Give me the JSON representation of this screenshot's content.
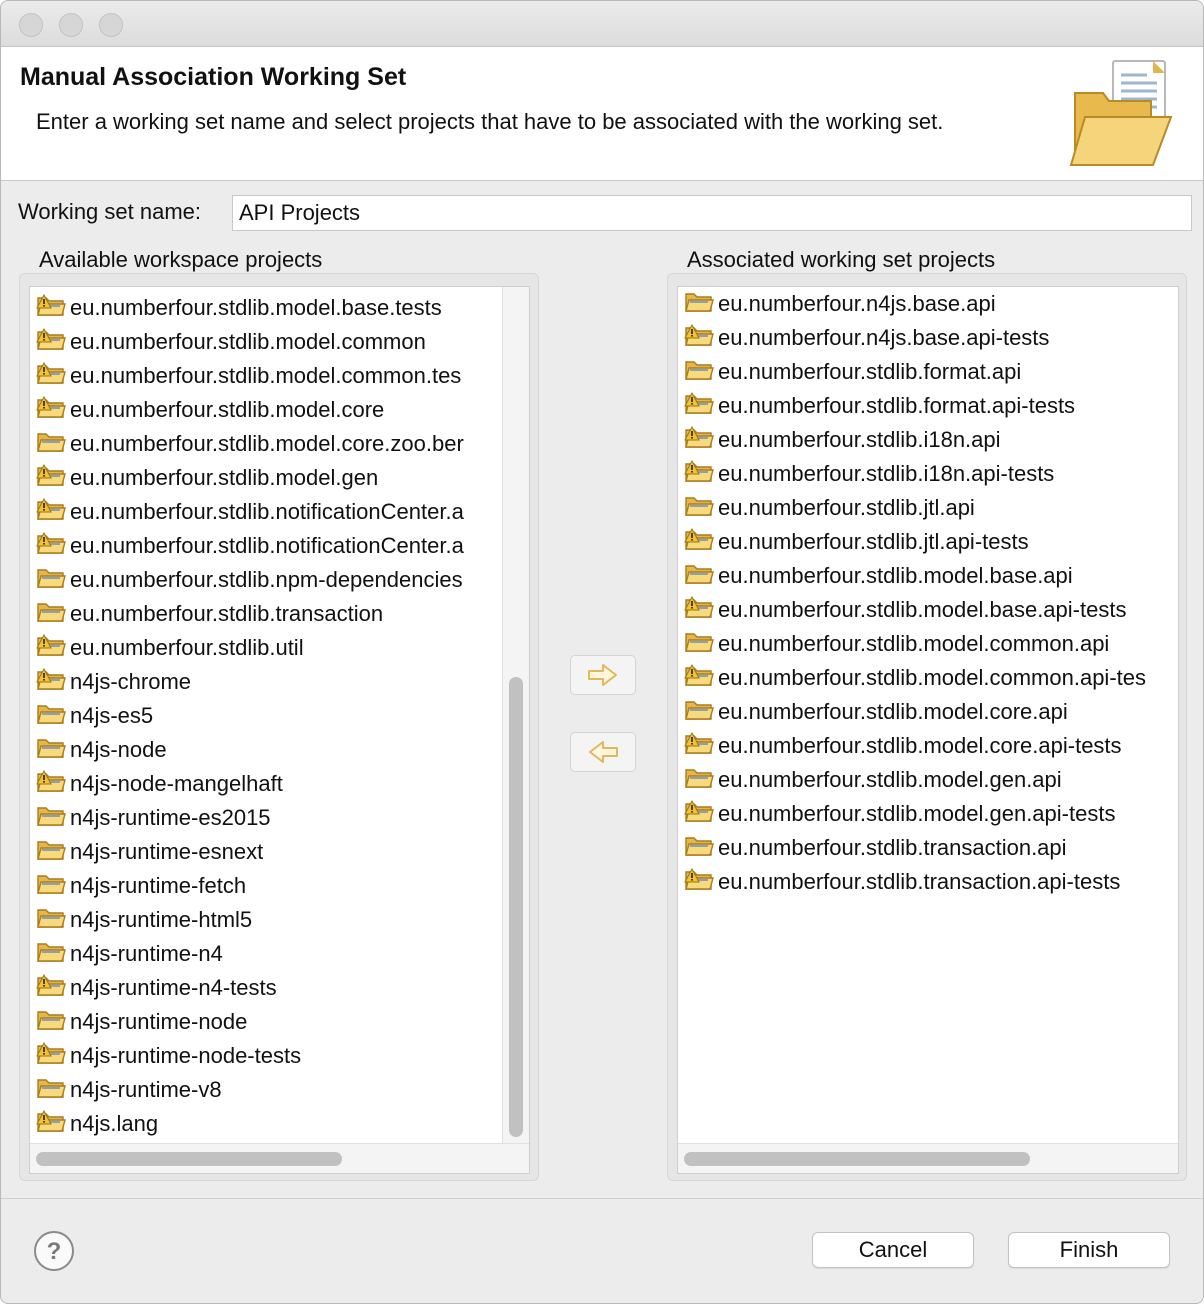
{
  "dialog": {
    "title": "Manual Association Working Set",
    "description": "Enter a working set name and select projects that have to be associated with the working set."
  },
  "working_set": {
    "label": "Working set name:",
    "value": "API Projects"
  },
  "available": {
    "label": "Available workspace projects",
    "items": [
      {
        "name": "eu.numberfour.stdlib.model.base.tests",
        "warning": true
      },
      {
        "name": "eu.numberfour.stdlib.model.common",
        "warning": true
      },
      {
        "name": "eu.numberfour.stdlib.model.common.tes",
        "warning": true
      },
      {
        "name": "eu.numberfour.stdlib.model.core",
        "warning": true
      },
      {
        "name": "eu.numberfour.stdlib.model.core.zoo.ber",
        "warning": false
      },
      {
        "name": "eu.numberfour.stdlib.model.gen",
        "warning": true
      },
      {
        "name": "eu.numberfour.stdlib.notificationCenter.a",
        "warning": true
      },
      {
        "name": "eu.numberfour.stdlib.notificationCenter.a",
        "warning": true
      },
      {
        "name": "eu.numberfour.stdlib.npm-dependencies",
        "warning": false
      },
      {
        "name": "eu.numberfour.stdlib.transaction",
        "warning": false
      },
      {
        "name": "eu.numberfour.stdlib.util",
        "warning": true
      },
      {
        "name": "n4js-chrome",
        "warning": true
      },
      {
        "name": "n4js-es5",
        "warning": false
      },
      {
        "name": "n4js-node",
        "warning": false
      },
      {
        "name": "n4js-node-mangelhaft",
        "warning": true
      },
      {
        "name": "n4js-runtime-es2015",
        "warning": false
      },
      {
        "name": "n4js-runtime-esnext",
        "warning": false
      },
      {
        "name": "n4js-runtime-fetch",
        "warning": false
      },
      {
        "name": "n4js-runtime-html5",
        "warning": false
      },
      {
        "name": "n4js-runtime-n4",
        "warning": false
      },
      {
        "name": "n4js-runtime-n4-tests",
        "warning": true
      },
      {
        "name": "n4js-runtime-node",
        "warning": false
      },
      {
        "name": "n4js-runtime-node-tests",
        "warning": true
      },
      {
        "name": "n4js-runtime-v8",
        "warning": false
      },
      {
        "name": "n4js.lang",
        "warning": true
      }
    ]
  },
  "associated": {
    "label": "Associated working set projects",
    "items": [
      {
        "name": "eu.numberfour.n4js.base.api",
        "warning": false
      },
      {
        "name": "eu.numberfour.n4js.base.api-tests",
        "warning": true
      },
      {
        "name": "eu.numberfour.stdlib.format.api",
        "warning": false
      },
      {
        "name": "eu.numberfour.stdlib.format.api-tests",
        "warning": true
      },
      {
        "name": "eu.numberfour.stdlib.i18n.api",
        "warning": true
      },
      {
        "name": "eu.numberfour.stdlib.i18n.api-tests",
        "warning": true
      },
      {
        "name": "eu.numberfour.stdlib.jtl.api",
        "warning": false
      },
      {
        "name": "eu.numberfour.stdlib.jtl.api-tests",
        "warning": true
      },
      {
        "name": "eu.numberfour.stdlib.model.base.api",
        "warning": false
      },
      {
        "name": "eu.numberfour.stdlib.model.base.api-tests",
        "warning": true
      },
      {
        "name": "eu.numberfour.stdlib.model.common.api",
        "warning": false
      },
      {
        "name": "eu.numberfour.stdlib.model.common.api-tes",
        "warning": true
      },
      {
        "name": "eu.numberfour.stdlib.model.core.api",
        "warning": false
      },
      {
        "name": "eu.numberfour.stdlib.model.core.api-tests",
        "warning": true
      },
      {
        "name": "eu.numberfour.stdlib.model.gen.api",
        "warning": false
      },
      {
        "name": "eu.numberfour.stdlib.model.gen.api-tests",
        "warning": true
      },
      {
        "name": "eu.numberfour.stdlib.transaction.api",
        "warning": false
      },
      {
        "name": "eu.numberfour.stdlib.transaction.api-tests",
        "warning": true
      }
    ]
  },
  "buttons": {
    "cancel": "Cancel",
    "finish": "Finish"
  },
  "icons": {
    "add": "arrow-right-icon",
    "remove": "arrow-left-icon",
    "help": "help-icon",
    "project": "project-folder-icon",
    "warning": "warning-icon"
  },
  "colors": {
    "folder": "#f3c85c",
    "warning": "#f1c232",
    "arrow_disabled": "#e8c87a"
  }
}
